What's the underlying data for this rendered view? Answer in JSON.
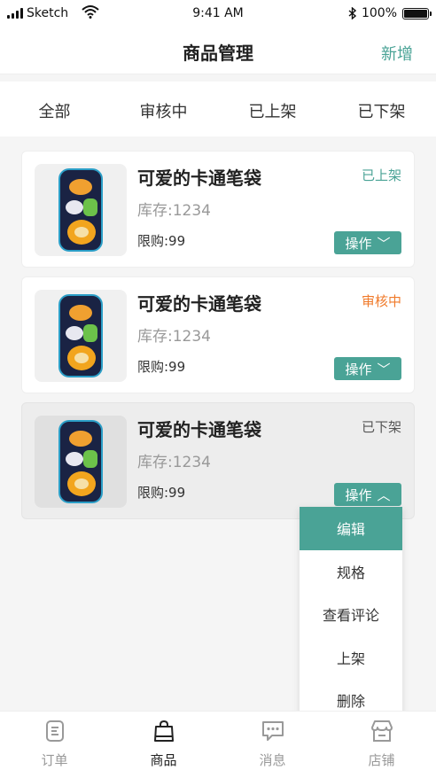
{
  "status_bar": {
    "carrier": "Sketch",
    "time": "9:41 AM",
    "battery": "100%",
    "bluetooth_glyph": "∗"
  },
  "nav": {
    "title": "商品管理",
    "add_label": "新增"
  },
  "tabs": [
    {
      "label": "全部",
      "active": true
    },
    {
      "label": "审核中",
      "active": false
    },
    {
      "label": "已上架",
      "active": false
    },
    {
      "label": "已下架",
      "active": false
    }
  ],
  "products": [
    {
      "title": "可爱的卡通笔袋",
      "stock": "库存:1234",
      "limit": "限购:99",
      "status": "已上架",
      "status_color": "#4aa396",
      "op_label": "操作",
      "op_arrow": "﹀"
    },
    {
      "title": "可爱的卡通笔袋",
      "stock": "库存:1234",
      "limit": "限购:99",
      "status": "审核中",
      "status_color": "#f07a2a",
      "op_label": "操作",
      "op_arrow": "﹀"
    },
    {
      "title": "可爱的卡通笔袋",
      "stock": "库存:1234",
      "limit": "限购:99",
      "status": "已下架",
      "status_color": "#555555",
      "op_label": "操作",
      "op_arrow": "︿"
    }
  ],
  "dropdown": [
    {
      "label": "编辑",
      "active": true
    },
    {
      "label": "规格",
      "active": false
    },
    {
      "label": "查看评论",
      "active": false
    },
    {
      "label": "上架",
      "active": false
    },
    {
      "label": "删除",
      "active": false
    }
  ],
  "tabbar": [
    {
      "label": "订单",
      "icon": "order-icon",
      "active": false
    },
    {
      "label": "商品",
      "icon": "bag-icon",
      "active": true
    },
    {
      "label": "消息",
      "icon": "message-icon",
      "active": false
    },
    {
      "label": "店铺",
      "icon": "store-icon",
      "active": false
    }
  ],
  "colors": {
    "accent": "#4aa396",
    "pending": "#f07a2a",
    "offline": "#555555"
  }
}
